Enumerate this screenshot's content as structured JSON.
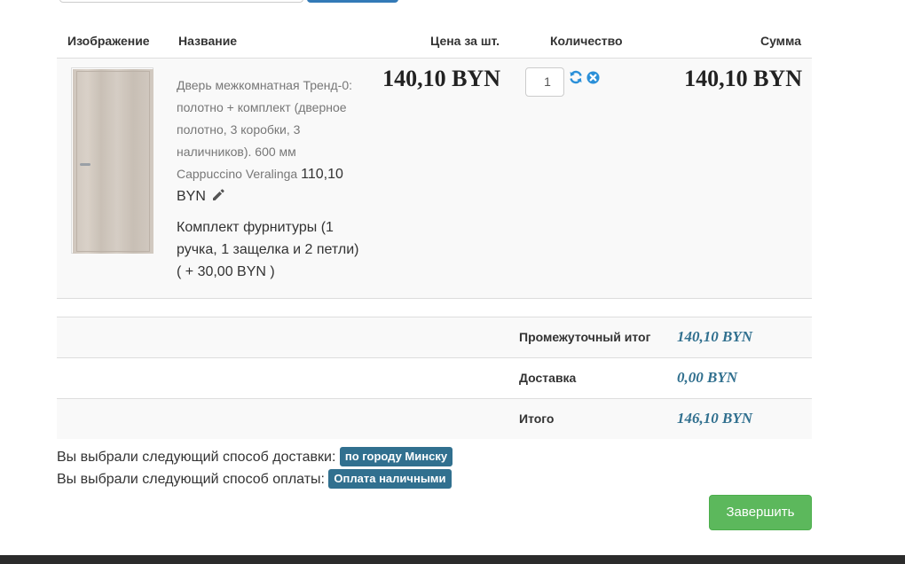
{
  "table_headers": {
    "image": "Изображение",
    "name": "Название",
    "unit_price": "Цена за шт.",
    "quantity": "Количество",
    "sum": "Сумма"
  },
  "product": {
    "name": "Дверь межкомнатная Тренд-0: полотно + комплект (дверное полотно, 3 коробки, 3 наличников). 600 мм Cappuccino Veralinga",
    "inline_price": "110,10 BYN",
    "option": "Комплект фурнитуры (1 ручка, 1 защелка и 2 петли) ( + 30,00 BYN )",
    "unit_price": "140,10 BYN",
    "quantity": "1",
    "total": "140,10 BYN"
  },
  "totals": [
    {
      "label": "Промежуточный итог",
      "value": "140,10 BYN"
    },
    {
      "label": "Доставка",
      "value": "0,00 BYN"
    },
    {
      "label": "Итого",
      "value": "146,10 BYN"
    }
  ],
  "delivery": {
    "text": "Вы выбрали следующий способ доставки:",
    "badge": "по городу Минску"
  },
  "payment": {
    "text": "Вы выбрали следующий способ оплаты:",
    "badge": "Оплата наличными"
  },
  "finish_button": "Завершить",
  "icons": {
    "edit": "pencil-icon",
    "refresh": "refresh-icon",
    "remove": "remove-icon"
  },
  "colors": {
    "primary": "#337ab7",
    "info": "#31708f",
    "success": "#5cb85c"
  }
}
